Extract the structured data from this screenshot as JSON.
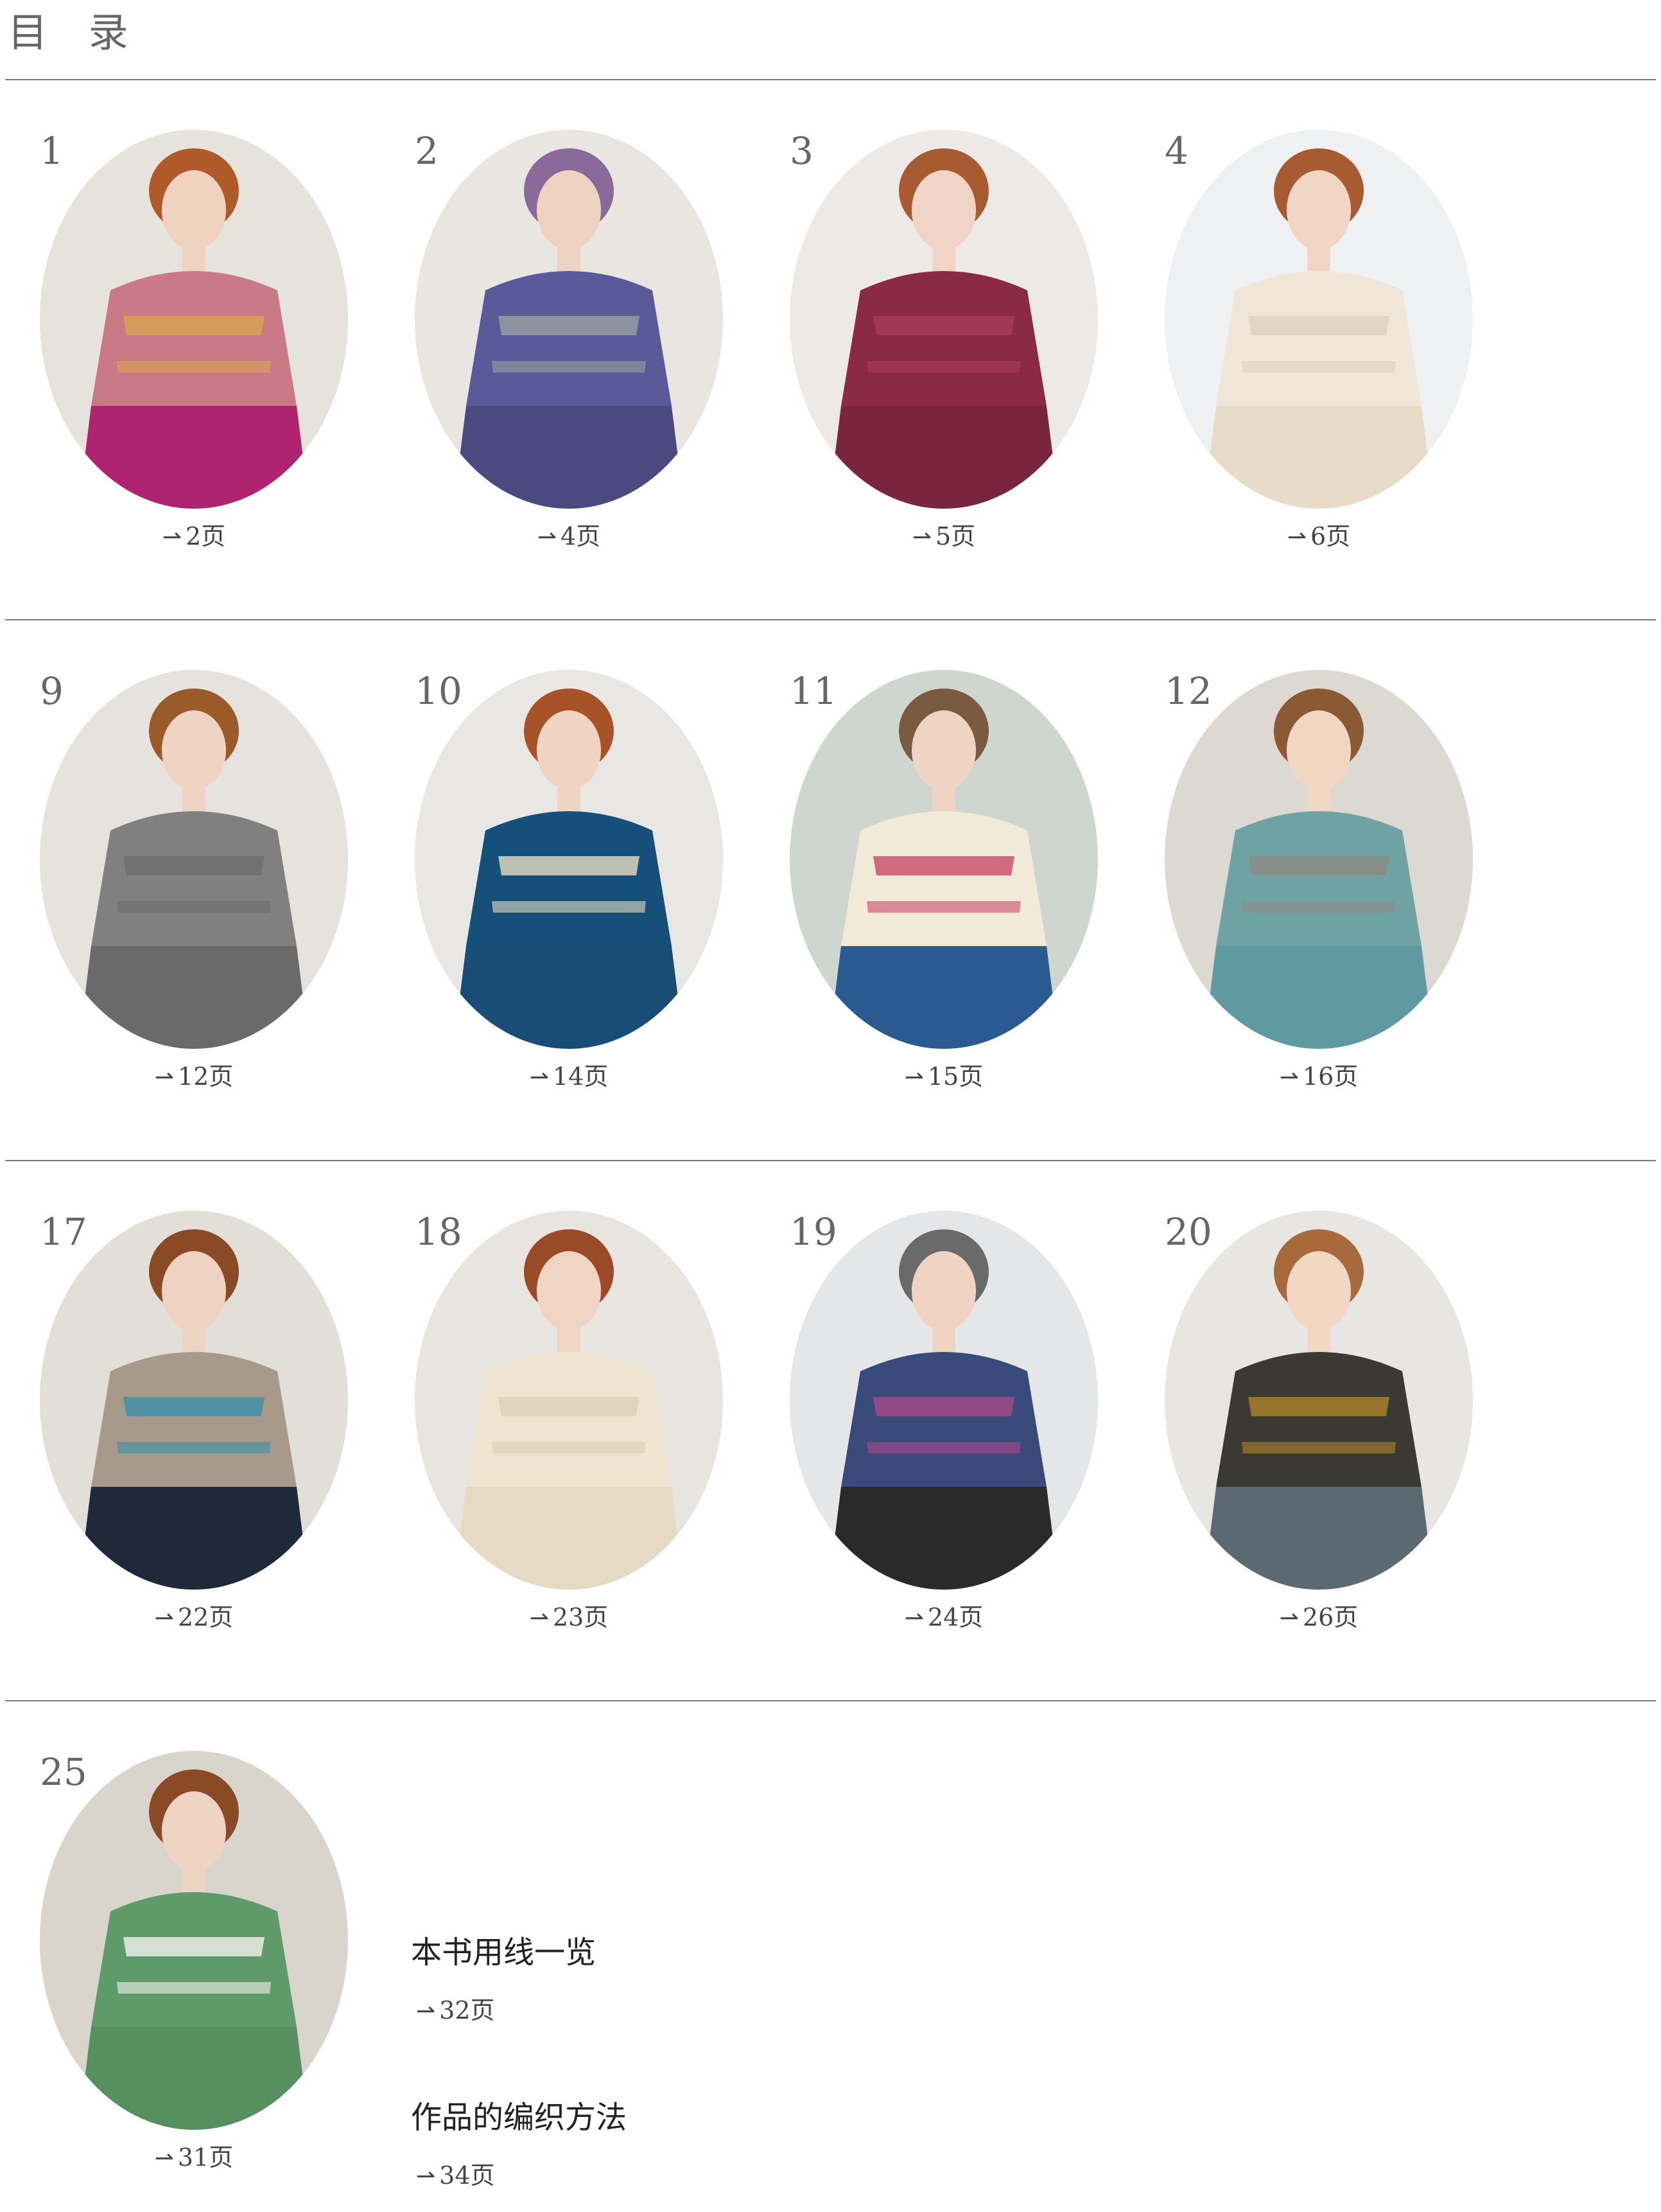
{
  "title": "目 录",
  "arrow_glyph": "⇀",
  "rows": [
    {
      "items": [
        {
          "num": "1",
          "page": "2页",
          "bg": "#e6e2dc",
          "top_color": "#c97a86",
          "accent": "#d8a64d",
          "bottom_color": "#b0236e",
          "skin": "#f0d2c0",
          "hair": "#b05a2a"
        },
        {
          "num": "2",
          "page": "4页",
          "bg": "#e9e6e2",
          "top_color": "#5a5a9a",
          "accent": "#9aa0a0",
          "bottom_color": "#4a4a80",
          "skin": "#eed3c2",
          "hair": "#8a6a9a"
        },
        {
          "num": "3",
          "page": "5页",
          "bg": "#ece9e6",
          "top_color": "#8a2a45",
          "accent": "#a83b59",
          "bottom_color": "#7a2540",
          "skin": "#f0d5c6",
          "hair": "#a85a30"
        },
        {
          "num": "4",
          "page": "6页",
          "bg": "#eef0f2",
          "top_color": "#efe6d8",
          "accent": "#ddd2bf",
          "bottom_color": "#e8dcc8",
          "skin": "#f1d6c6",
          "hair": "#a85a30"
        }
      ]
    },
    {
      "items": [
        {
          "num": "9",
          "page": "12页",
          "bg": "#e6e2de",
          "top_color": "#808080",
          "accent": "#6d6d6d",
          "bottom_color": "#6a6a6a",
          "skin": "#efd3c3",
          "hair": "#9a5a2a"
        },
        {
          "num": "10",
          "page": "14页",
          "bg": "#e9e7e4",
          "top_color": "#15507a",
          "accent": "#e9dcc0",
          "bottom_color": "#1a4c78",
          "skin": "#f0d3c2",
          "hair": "#a8522a"
        },
        {
          "num": "11",
          "page": "15页",
          "bg": "#cfd6cf",
          "top_color": "#f1ead8",
          "accent": "#c94a6a",
          "bottom_color": "#2a5a90",
          "skin": "#efd4c4",
          "hair": "#7a5a40"
        },
        {
          "num": "12",
          "page": "16页",
          "bg": "#dcd8d2",
          "top_color": "#6fa3a3",
          "accent": "#8f8a84",
          "bottom_color": "#5e9aa0",
          "skin": "#f2d6c4",
          "hair": "#8a5a34"
        }
      ]
    },
    {
      "items": [
        {
          "num": "17",
          "page": "22页",
          "bg": "#e2ded8",
          "top_color": "#a89a8a",
          "accent": "#3a8fa8",
          "bottom_color": "#1e2a3a",
          "skin": "#efd3c2",
          "hair": "#8a4a26"
        },
        {
          "num": "18",
          "page": "23页",
          "bg": "#e8e5e1",
          "top_color": "#eee4d0",
          "accent": "#dccfb6",
          "bottom_color": "#e6dac4",
          "skin": "#f1d5c4",
          "hair": "#9a4a26"
        },
        {
          "num": "19",
          "page": "24页",
          "bg": "#e4e6e7",
          "top_color": "#3a4a7a",
          "accent": "#a84a8a",
          "bottom_color": "#2a2a2a",
          "skin": "#efd3c3",
          "hair": "#6a6a6a"
        },
        {
          "num": "20",
          "page": "26页",
          "bg": "#e8e6e2",
          "top_color": "#3a3a32",
          "accent": "#b0822a",
          "bottom_color": "#5a6a70",
          "skin": "#f2d7c5",
          "hair": "#a86a3a"
        }
      ]
    },
    {
      "items": [
        {
          "num": "25",
          "page": "31页",
          "bg": "#d9d4cc",
          "top_color": "#5f9a6a",
          "accent": "#f4f1ec",
          "bottom_color": "#568f60",
          "skin": "#f0d4c3",
          "hair": "#8a4a26"
        }
      ]
    }
  ],
  "extras": [
    {
      "title": "本书用线一览",
      "page": "32页"
    },
    {
      "title": "作品的编织方法",
      "page": "34页"
    }
  ]
}
